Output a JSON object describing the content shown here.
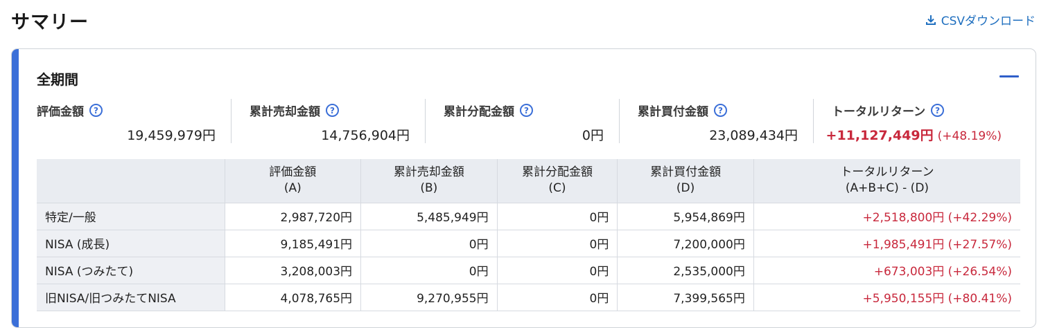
{
  "header": {
    "title": "サマリー",
    "csv_label": "CSVダウンロード"
  },
  "colors": {
    "accent": "#3b6fd8",
    "link": "#1f6fbf",
    "negative_red": "#c8283c"
  },
  "section": {
    "title": "全期間"
  },
  "metrics": [
    {
      "label": "評価金額",
      "value": "19,459,979円"
    },
    {
      "label": "累計売却金額",
      "value": "14,756,904円"
    },
    {
      "label": "累計分配金額",
      "value": "0円"
    },
    {
      "label": "累計買付金額",
      "value": "23,089,434円"
    },
    {
      "label": "トータルリターン",
      "value": "+11,127,449円",
      "pct": "(+48.19%)"
    }
  ],
  "table": {
    "headers": [
      {
        "line1": "",
        "line2": ""
      },
      {
        "line1": "評価金額",
        "line2": "(A)"
      },
      {
        "line1": "累計売却金額",
        "line2": "(B)"
      },
      {
        "line1": "累計分配金額",
        "line2": "(C)"
      },
      {
        "line1": "累計買付金額",
        "line2": "(D)"
      },
      {
        "line1": "トータルリターン",
        "line2": "(A+B+C) - (D)"
      }
    ],
    "rows": [
      {
        "label": "特定/一般",
        "a": "2,987,720円",
        "b": "5,485,949円",
        "c": "0円",
        "d": "5,954,869円",
        "ret": "+2,518,800円 (+42.29%)"
      },
      {
        "label": "NISA (成長)",
        "a": "9,185,491円",
        "b": "0円",
        "c": "0円",
        "d": "7,200,000円",
        "ret": "+1,985,491円 (+27.57%)"
      },
      {
        "label": "NISA (つみたて)",
        "a": "3,208,003円",
        "b": "0円",
        "c": "0円",
        "d": "2,535,000円",
        "ret": "+673,003円 (+26.54%)"
      },
      {
        "label": "旧NISA/旧つみたてNISA",
        "a": "4,078,765円",
        "b": "9,270,955円",
        "c": "0円",
        "d": "7,399,565円",
        "ret": "+5,950,155円 (+80.41%)"
      }
    ]
  }
}
